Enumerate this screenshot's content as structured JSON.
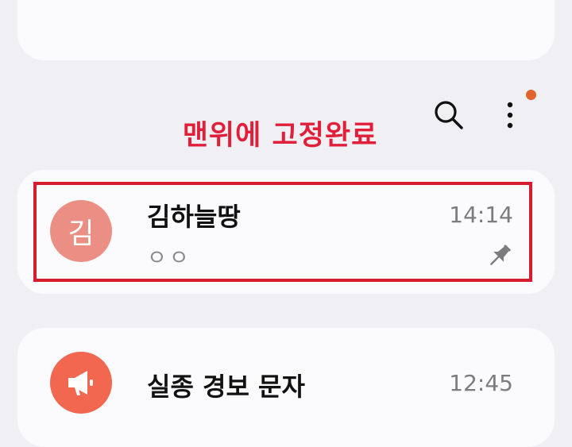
{
  "annotation": {
    "text": "맨위에 고정완료",
    "color": "#e0203a"
  },
  "toolbar": {
    "search_icon": "search-icon",
    "more_icon": "more-vertical-icon",
    "notification_dot_color": "#e2632b"
  },
  "conversations": [
    {
      "avatar_text": "김",
      "avatar_color": "#eb8f85",
      "name": "김하늘땅",
      "preview": "ㅇㅇ",
      "time": "14:14",
      "pinned": true,
      "pin_icon": "pin-icon"
    },
    {
      "avatar_icon": "megaphone-icon",
      "avatar_color": "#f2674f",
      "name": "실종 경보 문자",
      "time": "12:45"
    }
  ],
  "highlight_color": "#d81c30"
}
